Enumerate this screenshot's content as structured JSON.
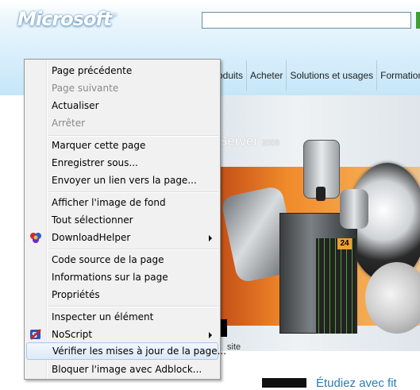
{
  "page": {
    "logo": "Microsoft",
    "nav": [
      "roduits",
      "Acheter",
      "Solutions et usages",
      "Formations"
    ],
    "banner": {
      "title": "Server",
      "year": "2008",
      "badge": "24",
      "link_text": "site"
    },
    "bottom_title": "Étudiez avec fit"
  },
  "context_menu": {
    "items": [
      {
        "label": "Page précédente",
        "enabled": true
      },
      {
        "label": "Page suivante",
        "enabled": false
      },
      {
        "label": "Actualiser",
        "enabled": true
      },
      {
        "label": "Arrêter",
        "enabled": false
      },
      {
        "label": "Marquer cette page",
        "enabled": true
      },
      {
        "label": "Enregistrer sous...",
        "enabled": true
      },
      {
        "label": "Envoyer un lien vers la page...",
        "enabled": true
      },
      {
        "label": "Afficher l'image de fond",
        "enabled": true
      },
      {
        "label": "Tout sélectionner",
        "enabled": true
      },
      {
        "label": "DownloadHelper",
        "enabled": true,
        "submenu": true,
        "icon": "downloadhelper-icon"
      },
      {
        "label": "Code source de la page",
        "enabled": true
      },
      {
        "label": "Informations sur la page",
        "enabled": true
      },
      {
        "label": "Propriétés",
        "enabled": true
      },
      {
        "label": "Inspecter un élément",
        "enabled": true
      },
      {
        "label": "NoScript",
        "enabled": true,
        "submenu": true,
        "icon": "noscript-icon"
      },
      {
        "label": "Vérifier les mises à jour de la page...",
        "enabled": true,
        "highlighted": true
      },
      {
        "label": "Bloquer l'image avec Adblock...",
        "enabled": true
      }
    ]
  },
  "colors": {
    "highlight_border": "#a8c8ea",
    "menu_bg": "#f1f1f1",
    "link_blue": "#2c7bb8"
  }
}
